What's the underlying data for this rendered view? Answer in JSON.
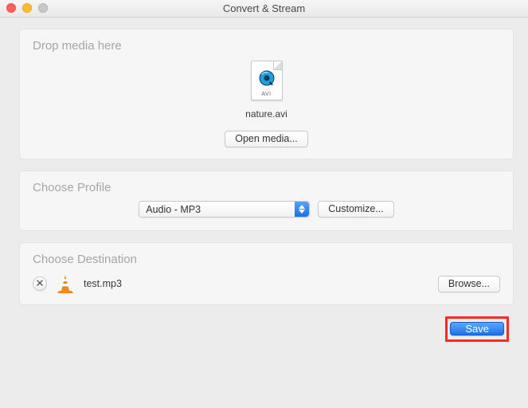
{
  "window": {
    "title": "Convert & Stream"
  },
  "drop": {
    "title": "Drop media here",
    "file_badge": "AVI",
    "filename": "nature.avi",
    "open_label": "Open media..."
  },
  "profile": {
    "title": "Choose Profile",
    "selected": "Audio - MP3",
    "customize_label": "Customize..."
  },
  "destination": {
    "title": "Choose Destination",
    "filename": "test.mp3",
    "browse_label": "Browse..."
  },
  "footer": {
    "save_label": "Save"
  },
  "icons": {
    "close": "close-traffic-light",
    "minimize": "minimize-traffic-light",
    "zoom": "zoom-traffic-light",
    "quicktime": "quicktime-icon",
    "select_stepper": "up-down-chevrons-icon",
    "remove": "x-icon",
    "vlc": "vlc-cone-icon"
  }
}
